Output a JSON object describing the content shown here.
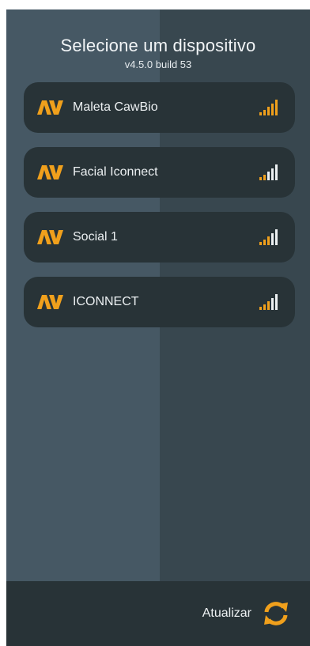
{
  "header": {
    "title": "Selecione um dispositivo",
    "version": "v4.5.0 build 53"
  },
  "devices": [
    {
      "name": "Maleta CawBio",
      "signal_icon": "signal-bars-icon"
    },
    {
      "name": "Facial Iconnect",
      "signal_icon": "signal-bars-icon"
    },
    {
      "name": "Social 1",
      "signal_icon": "signal-bars-icon"
    },
    {
      "name": "ICONNECT",
      "signal_icon": "signal-bars-icon"
    }
  ],
  "footer": {
    "refresh_label": "Atualizar",
    "refresh_icon": "refresh-icon"
  },
  "colors": {
    "accent": "#f0a01c",
    "card": "#283337",
    "panel_left": "#465864",
    "panel_right": "#38474f"
  }
}
